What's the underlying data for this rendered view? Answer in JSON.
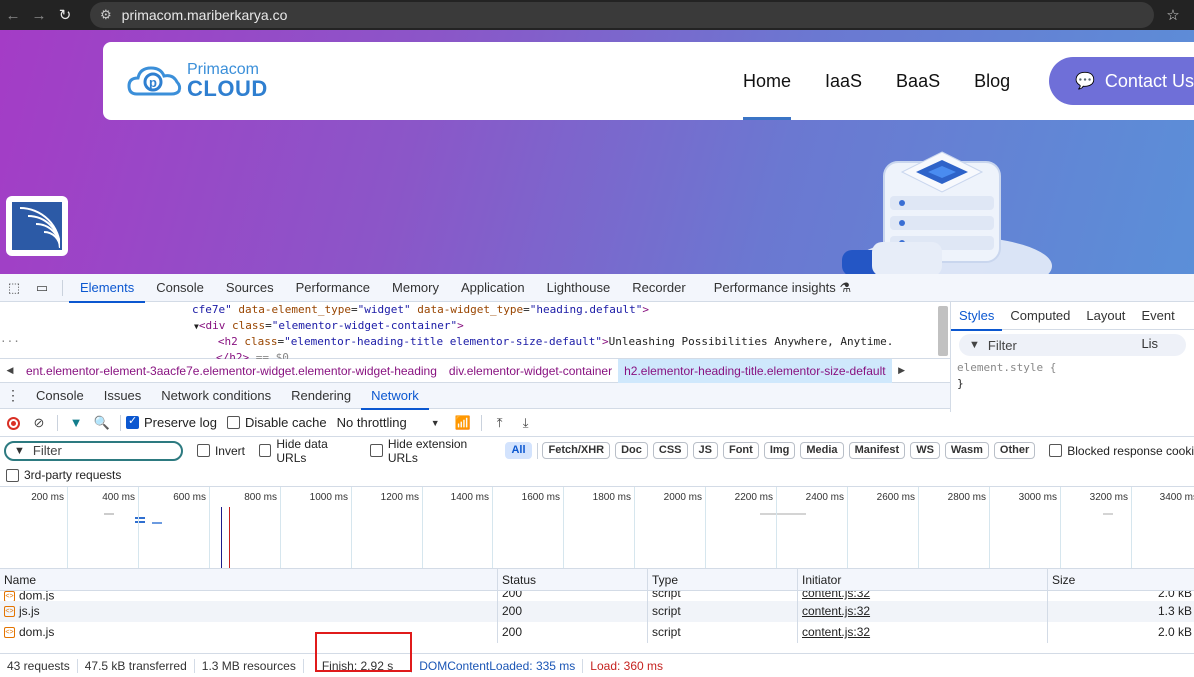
{
  "browser": {
    "url": "primacom.mariberkarya.co",
    "icons": [
      "back-icon",
      "forward-icon",
      "reload-icon",
      "site-settings-icon",
      "bookmark-star-icon"
    ]
  },
  "site": {
    "logo_line1": "Primacom",
    "logo_line2": "CLOUD",
    "menu": [
      "Home",
      "IaaS",
      "BaaS",
      "Blog"
    ],
    "active_menu": "Home",
    "contact_label": "Contact Us"
  },
  "devtools": {
    "main_tabs": [
      "Elements",
      "Console",
      "Sources",
      "Performance",
      "Memory",
      "Application",
      "Lighthouse",
      "Recorder",
      "Performance insights"
    ],
    "active_main_tab": "Elements",
    "dom_lines": {
      "l1_pre": "cfe7e\"",
      "l1_a1": "data-element_type",
      "l1_v1": "\"widget\"",
      "l1_a2": "data-widget_type",
      "l1_v2": "\"heading.default\"",
      "l2_tag": "<div",
      "l2_attr": "class",
      "l2_val": "\"elementor-widget-container\"",
      "l3_tag": "<h2",
      "l3_attr": "class",
      "l3_val": "\"elementor-heading-title elementor-size-default\"",
      "l3_text": "Unleashing Possibilities Anywhere, Anytime.",
      "l4_tag": "</h2>",
      "l4_dim": "== $0"
    },
    "styles_tabs": [
      "Styles",
      "Computed",
      "Layout",
      "Event Lis"
    ],
    "styles_filter_placeholder": "Filter",
    "element_style": "element.style {",
    "element_style_close": "}",
    "breadcrumbs": [
      "ent.elementor-element-3aacfe7e.elementor-widget.elementor-widget-heading",
      "div.elementor-widget-container",
      "h2.elementor-heading-title.elementor-size-default"
    ],
    "drawer_tabs": [
      "Console",
      "Issues",
      "Network conditions",
      "Rendering",
      "Network"
    ],
    "active_drawer_tab": "Network"
  },
  "network": {
    "preserve_log": "Preserve log",
    "disable_cache": "Disable cache",
    "throttling": "No throttling",
    "filter_placeholder": "Filter",
    "invert": "Invert",
    "hide_data_urls": "Hide data URLs",
    "hide_extension_urls": "Hide extension URLs",
    "type_filters": [
      "All",
      "Fetch/XHR",
      "Doc",
      "CSS",
      "JS",
      "Font",
      "Img",
      "Media",
      "Manifest",
      "WS",
      "Wasm",
      "Other"
    ],
    "active_type_filter": "All",
    "blocked_response": "Blocked response cooki",
    "third_party": "3rd-party requests",
    "timeline_ticks": [
      "200 ms",
      "400 ms",
      "600 ms",
      "800 ms",
      "1000 ms",
      "1200 ms",
      "1400 ms",
      "1600 ms",
      "1800 ms",
      "2000 ms",
      "2200 ms",
      "2400 ms",
      "2600 ms",
      "2800 ms",
      "3000 ms",
      "3200 ms",
      "3400 ms"
    ],
    "columns": [
      "Name",
      "Status",
      "Type",
      "Initiator",
      "Size"
    ],
    "rows": [
      {
        "name": "dom.js",
        "status": "200",
        "type": "script",
        "initiator": "content.js:32",
        "size": "2.0 kB"
      },
      {
        "name": "js.js",
        "status": "200",
        "type": "script",
        "initiator": "content.js:32",
        "size": "1.3 kB"
      },
      {
        "name": "dom.js",
        "status": "200",
        "type": "script",
        "initiator": "content.js:32",
        "size": "2.0 kB"
      }
    ],
    "summary": {
      "requests": "43 requests",
      "transferred": "47.5 kB transferred",
      "resources": "1.3 MB resources",
      "finish": "Finish: 2.92 s",
      "dcl": "DOMContentLoaded: 335 ms",
      "load": "Load: 360 ms"
    }
  },
  "colors": {
    "accent": "#0b57d0",
    "highlight_box": "#e01b1b",
    "dcl": "#1a55b5",
    "load": "#c5221f"
  }
}
